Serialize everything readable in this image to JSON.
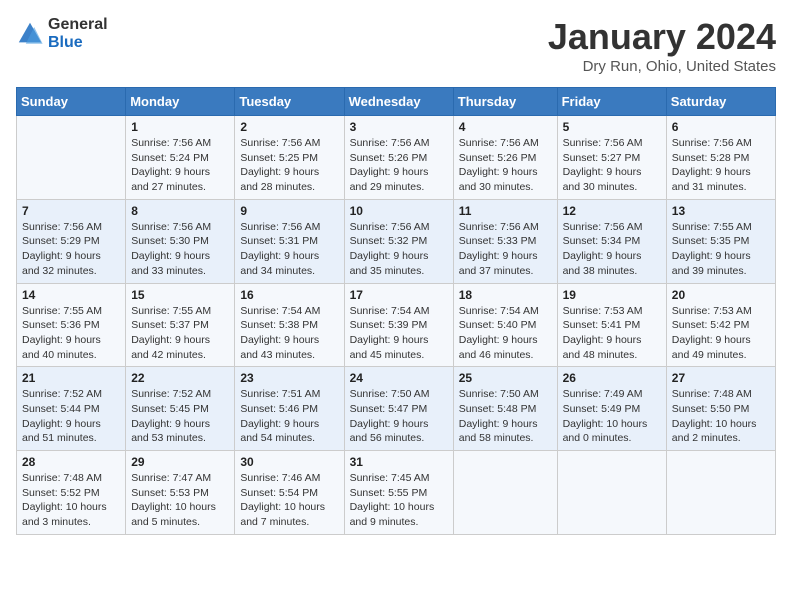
{
  "logo": {
    "line1": "General",
    "line2": "Blue"
  },
  "title": "January 2024",
  "subtitle": "Dry Run, Ohio, United States",
  "weekdays": [
    "Sunday",
    "Monday",
    "Tuesday",
    "Wednesday",
    "Thursday",
    "Friday",
    "Saturday"
  ],
  "weeks": [
    [
      {
        "day": "",
        "info": ""
      },
      {
        "day": "1",
        "info": "Sunrise: 7:56 AM\nSunset: 5:24 PM\nDaylight: 9 hours\nand 27 minutes."
      },
      {
        "day": "2",
        "info": "Sunrise: 7:56 AM\nSunset: 5:25 PM\nDaylight: 9 hours\nand 28 minutes."
      },
      {
        "day": "3",
        "info": "Sunrise: 7:56 AM\nSunset: 5:26 PM\nDaylight: 9 hours\nand 29 minutes."
      },
      {
        "day": "4",
        "info": "Sunrise: 7:56 AM\nSunset: 5:26 PM\nDaylight: 9 hours\nand 30 minutes."
      },
      {
        "day": "5",
        "info": "Sunrise: 7:56 AM\nSunset: 5:27 PM\nDaylight: 9 hours\nand 30 minutes."
      },
      {
        "day": "6",
        "info": "Sunrise: 7:56 AM\nSunset: 5:28 PM\nDaylight: 9 hours\nand 31 minutes."
      }
    ],
    [
      {
        "day": "7",
        "info": "Sunrise: 7:56 AM\nSunset: 5:29 PM\nDaylight: 9 hours\nand 32 minutes."
      },
      {
        "day": "8",
        "info": "Sunrise: 7:56 AM\nSunset: 5:30 PM\nDaylight: 9 hours\nand 33 minutes."
      },
      {
        "day": "9",
        "info": "Sunrise: 7:56 AM\nSunset: 5:31 PM\nDaylight: 9 hours\nand 34 minutes."
      },
      {
        "day": "10",
        "info": "Sunrise: 7:56 AM\nSunset: 5:32 PM\nDaylight: 9 hours\nand 35 minutes."
      },
      {
        "day": "11",
        "info": "Sunrise: 7:56 AM\nSunset: 5:33 PM\nDaylight: 9 hours\nand 37 minutes."
      },
      {
        "day": "12",
        "info": "Sunrise: 7:56 AM\nSunset: 5:34 PM\nDaylight: 9 hours\nand 38 minutes."
      },
      {
        "day": "13",
        "info": "Sunrise: 7:55 AM\nSunset: 5:35 PM\nDaylight: 9 hours\nand 39 minutes."
      }
    ],
    [
      {
        "day": "14",
        "info": "Sunrise: 7:55 AM\nSunset: 5:36 PM\nDaylight: 9 hours\nand 40 minutes."
      },
      {
        "day": "15",
        "info": "Sunrise: 7:55 AM\nSunset: 5:37 PM\nDaylight: 9 hours\nand 42 minutes."
      },
      {
        "day": "16",
        "info": "Sunrise: 7:54 AM\nSunset: 5:38 PM\nDaylight: 9 hours\nand 43 minutes."
      },
      {
        "day": "17",
        "info": "Sunrise: 7:54 AM\nSunset: 5:39 PM\nDaylight: 9 hours\nand 45 minutes."
      },
      {
        "day": "18",
        "info": "Sunrise: 7:54 AM\nSunset: 5:40 PM\nDaylight: 9 hours\nand 46 minutes."
      },
      {
        "day": "19",
        "info": "Sunrise: 7:53 AM\nSunset: 5:41 PM\nDaylight: 9 hours\nand 48 minutes."
      },
      {
        "day": "20",
        "info": "Sunrise: 7:53 AM\nSunset: 5:42 PM\nDaylight: 9 hours\nand 49 minutes."
      }
    ],
    [
      {
        "day": "21",
        "info": "Sunrise: 7:52 AM\nSunset: 5:44 PM\nDaylight: 9 hours\nand 51 minutes."
      },
      {
        "day": "22",
        "info": "Sunrise: 7:52 AM\nSunset: 5:45 PM\nDaylight: 9 hours\nand 53 minutes."
      },
      {
        "day": "23",
        "info": "Sunrise: 7:51 AM\nSunset: 5:46 PM\nDaylight: 9 hours\nand 54 minutes."
      },
      {
        "day": "24",
        "info": "Sunrise: 7:50 AM\nSunset: 5:47 PM\nDaylight: 9 hours\nand 56 minutes."
      },
      {
        "day": "25",
        "info": "Sunrise: 7:50 AM\nSunset: 5:48 PM\nDaylight: 9 hours\nand 58 minutes."
      },
      {
        "day": "26",
        "info": "Sunrise: 7:49 AM\nSunset: 5:49 PM\nDaylight: 10 hours\nand 0 minutes."
      },
      {
        "day": "27",
        "info": "Sunrise: 7:48 AM\nSunset: 5:50 PM\nDaylight: 10 hours\nand 2 minutes."
      }
    ],
    [
      {
        "day": "28",
        "info": "Sunrise: 7:48 AM\nSunset: 5:52 PM\nDaylight: 10 hours\nand 3 minutes."
      },
      {
        "day": "29",
        "info": "Sunrise: 7:47 AM\nSunset: 5:53 PM\nDaylight: 10 hours\nand 5 minutes."
      },
      {
        "day": "30",
        "info": "Sunrise: 7:46 AM\nSunset: 5:54 PM\nDaylight: 10 hours\nand 7 minutes."
      },
      {
        "day": "31",
        "info": "Sunrise: 7:45 AM\nSunset: 5:55 PM\nDaylight: 10 hours\nand 9 minutes."
      },
      {
        "day": "",
        "info": ""
      },
      {
        "day": "",
        "info": ""
      },
      {
        "day": "",
        "info": ""
      }
    ]
  ]
}
